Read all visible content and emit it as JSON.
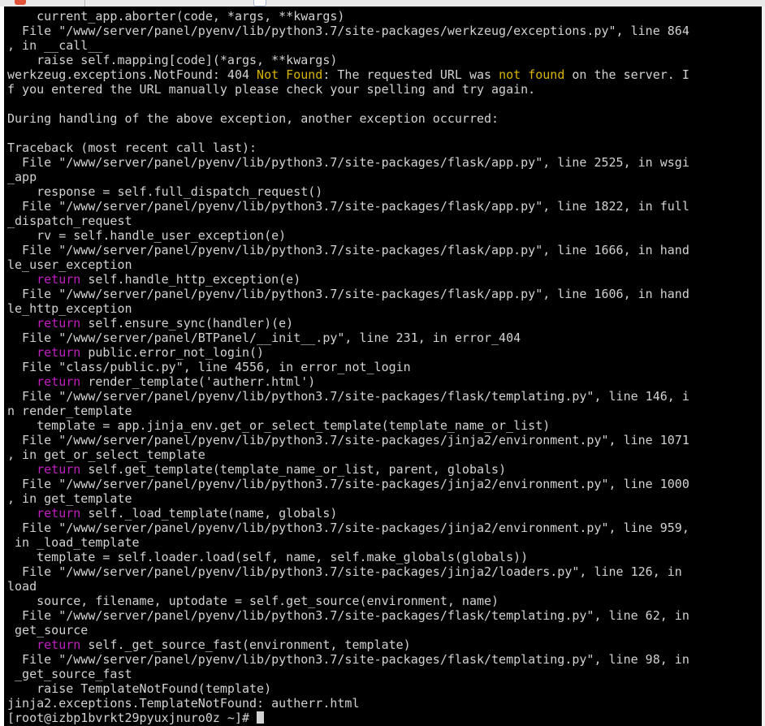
{
  "terminal": {
    "lines": [
      "    current_app.aborter(code, *args, **kwargs)",
      "  File \"/www/server/panel/pyenv/lib/python3.7/site-packages/werkzeug/exceptions.py\", line 864",
      ", in __call__",
      "    raise self.mapping[code](*args, **kwargs)",
      "werkzeug.exceptions.NotFound: 404 ",
      "f you entered the URL manually please check your spelling and try again.",
      "",
      "During handling of the above exception, another exception occurred:",
      "",
      "Traceback (most recent call last):",
      "  File \"/www/server/panel/pyenv/lib/python3.7/site-packages/flask/app.py\", line 2525, in wsgi",
      "_app",
      "    response = self.full_dispatch_request()",
      "  File \"/www/server/panel/pyenv/lib/python3.7/site-packages/flask/app.py\", line 1822, in full",
      "_dispatch_request",
      "    rv = self.handle_user_exception(e)",
      "  File \"/www/server/panel/pyenv/lib/python3.7/site-packages/flask/app.py\", line 1666, in hand",
      "le_user_exception",
      " self.handle_http_exception(e)",
      "  File \"/www/server/panel/pyenv/lib/python3.7/site-packages/flask/app.py\", line 1606, in hand",
      "le_http_exception",
      " self.ensure_sync(handler)(e)",
      "  File \"/www/server/panel/BTPanel/__init__.py\", line 231, in error_404",
      " public.error_not_login()",
      "  File \"class/public.py\", line 4556, in error_not_login",
      " render_template('autherr.html')",
      "  File \"/www/server/panel/pyenv/lib/python3.7/site-packages/flask/templating.py\", line 146, i",
      "n render_template",
      "    template = app.jinja_env.get_or_select_template(template_name_or_list)",
      "  File \"/www/server/panel/pyenv/lib/python3.7/site-packages/jinja2/environment.py\", line 1071",
      ", in get_or_select_template",
      " self.get_template(template_name_or_list, parent, globals)",
      "  File \"/www/server/panel/pyenv/lib/python3.7/site-packages/jinja2/environment.py\", line 1000",
      ", in get_template",
      " self._load_template(name, globals)",
      "  File \"/www/server/panel/pyenv/lib/python3.7/site-packages/jinja2/environment.py\", line 959,",
      " in _load_template",
      "    template = self.loader.load(self, name, self.make_globals(globals))",
      "  File \"/www/server/panel/pyenv/lib/python3.7/site-packages/jinja2/loaders.py\", line 126, in",
      "load",
      "    source, filename, uptodate = self.get_source(environment, name)",
      "  File \"/www/server/panel/pyenv/lib/python3.7/site-packages/flask/templating.py\", line 62, in",
      " get_source",
      " self._get_source_fast(environment, template)",
      "  File \"/www/server/panel/pyenv/lib/python3.7/site-packages/flask/templating.py\", line 98, in",
      " _get_source_fast",
      "    raise TemplateNotFound(template)",
      "jinja2.exceptions.TemplateNotFound: autherr.html",
      "[root@izbp1bvrkt29pyuxjnuro0z ~]# "
    ],
    "segments": {
      "notfound_label": "Not Found",
      "notfound_rest": ": The requested URL was ",
      "notfound_lower": "not found",
      "notfound_tail": " on the server. I",
      "return_kw": "return"
    },
    "colors": {
      "background": "#000000",
      "foreground": "#d2d2d2",
      "highlight": "#d8b400",
      "keyword": "#c21fc2"
    }
  }
}
